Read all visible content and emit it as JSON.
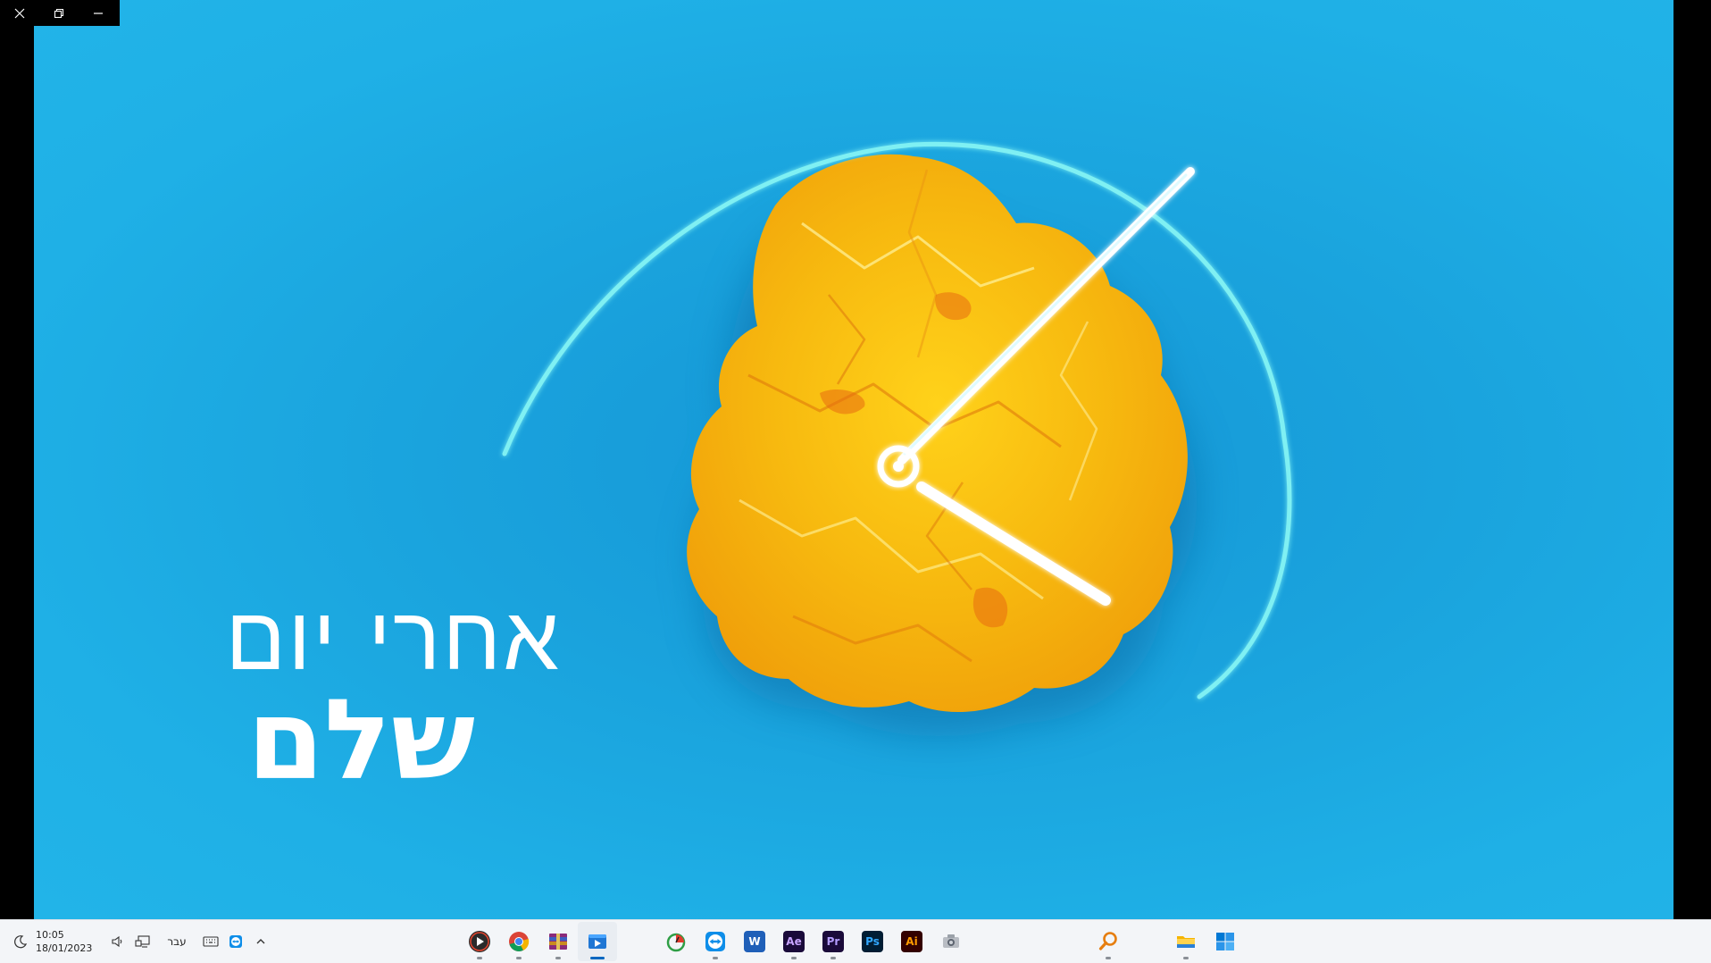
{
  "window": {
    "controls": {
      "close_icon": "close-icon",
      "restore_icon": "restore-icon",
      "minimize_icon": "minimize-icon"
    }
  },
  "video": {
    "title_line1": "אחרי יום",
    "title_line2": "שלם",
    "background_color": "#1fa9e2",
    "accent_color": "#f5c518"
  },
  "taskbar": {
    "clock": {
      "time": "10:05",
      "date": "18/01/2023"
    },
    "language": "עבר",
    "tray_icons": [
      "moon-icon",
      "volume-icon",
      "network-icon",
      "keyboard-icon",
      "teamviewer-tray-icon",
      "chevron-up-icon"
    ],
    "apps": [
      {
        "name": "media-player",
        "label": ""
      },
      {
        "name": "chrome",
        "label": ""
      },
      {
        "name": "winrar",
        "label": ""
      },
      {
        "name": "video-player",
        "label": ""
      },
      {
        "name": "stopwatch",
        "label": ""
      },
      {
        "name": "teamviewer",
        "label": ""
      },
      {
        "name": "word",
        "label": "W"
      },
      {
        "name": "after-effects",
        "label": "Ae"
      },
      {
        "name": "premiere",
        "label": "Pr"
      },
      {
        "name": "photoshop",
        "label": "Ps"
      },
      {
        "name": "illustrator",
        "label": "Ai"
      },
      {
        "name": "camera",
        "label": ""
      },
      {
        "name": "search",
        "label": ""
      },
      {
        "name": "file-explorer",
        "label": ""
      },
      {
        "name": "start",
        "label": ""
      }
    ]
  }
}
